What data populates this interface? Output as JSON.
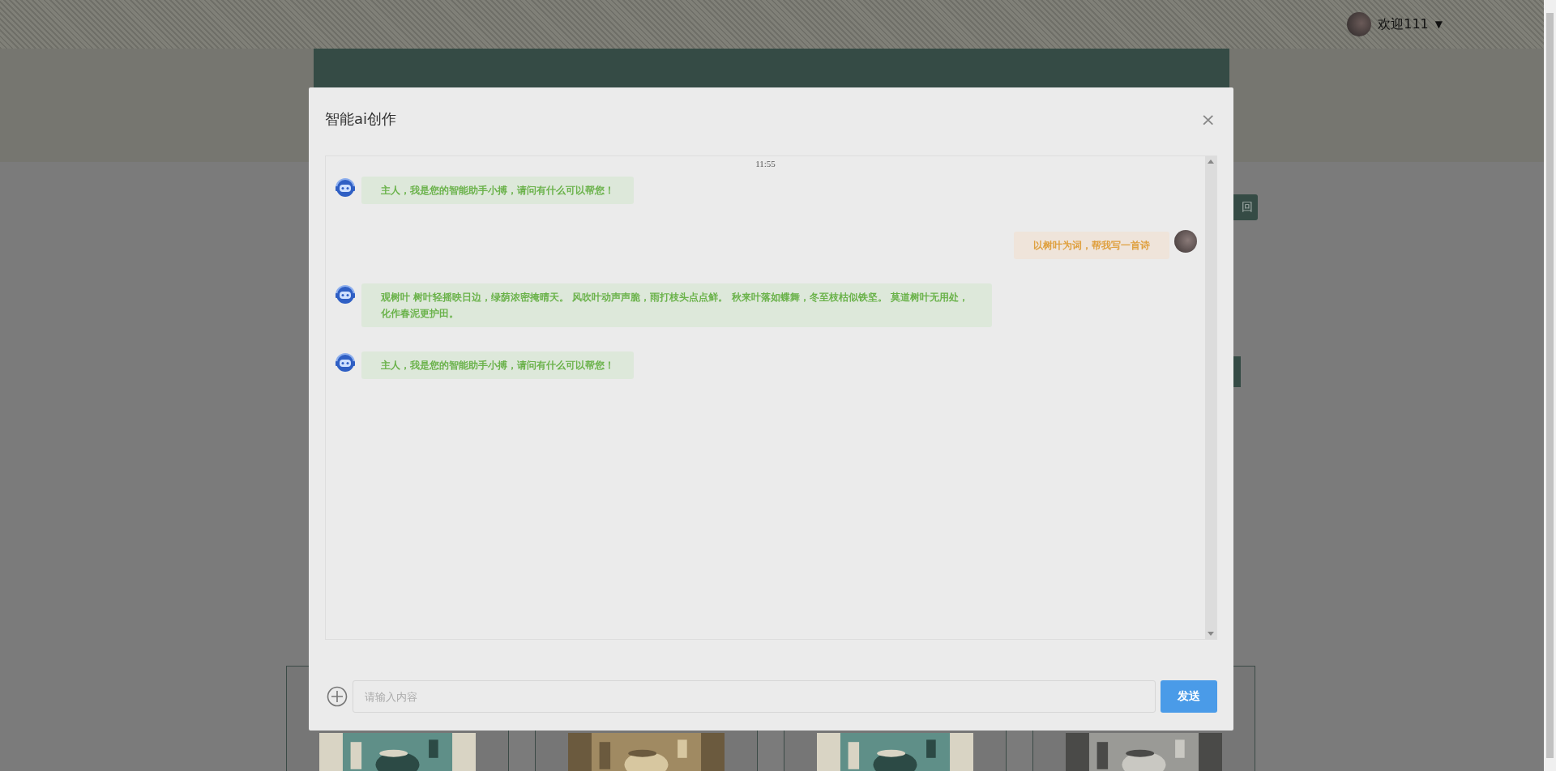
{
  "topbar": {
    "user": "欢迎111",
    "caret": "▼"
  },
  "back_button": "回",
  "dialog": {
    "title": "智能ai创作",
    "close": "×",
    "chat": {
      "time": "11:55",
      "messages": [
        {
          "kind": "bot",
          "text": "主人，我是您的智能助手小搏，请问有什么可以帮您！"
        },
        {
          "kind": "user",
          "text": "以树叶为词，帮我写一首诗"
        },
        {
          "kind": "bot",
          "text": "观树叶 树叶轻摇映日边，绿荫浓密掩晴天。 风吹叶动声声脆，雨打枝头点点鲜。 秋来叶落如蝶舞，冬至枝枯似铁坚。 莫道树叶无用处，化作春泥更护田。"
        },
        {
          "kind": "bot",
          "text": "主人，我是您的智能助手小搏，请问有什么可以帮您！"
        }
      ]
    },
    "input": {
      "placeholder": "请输入内容"
    },
    "send_button": "发送"
  }
}
